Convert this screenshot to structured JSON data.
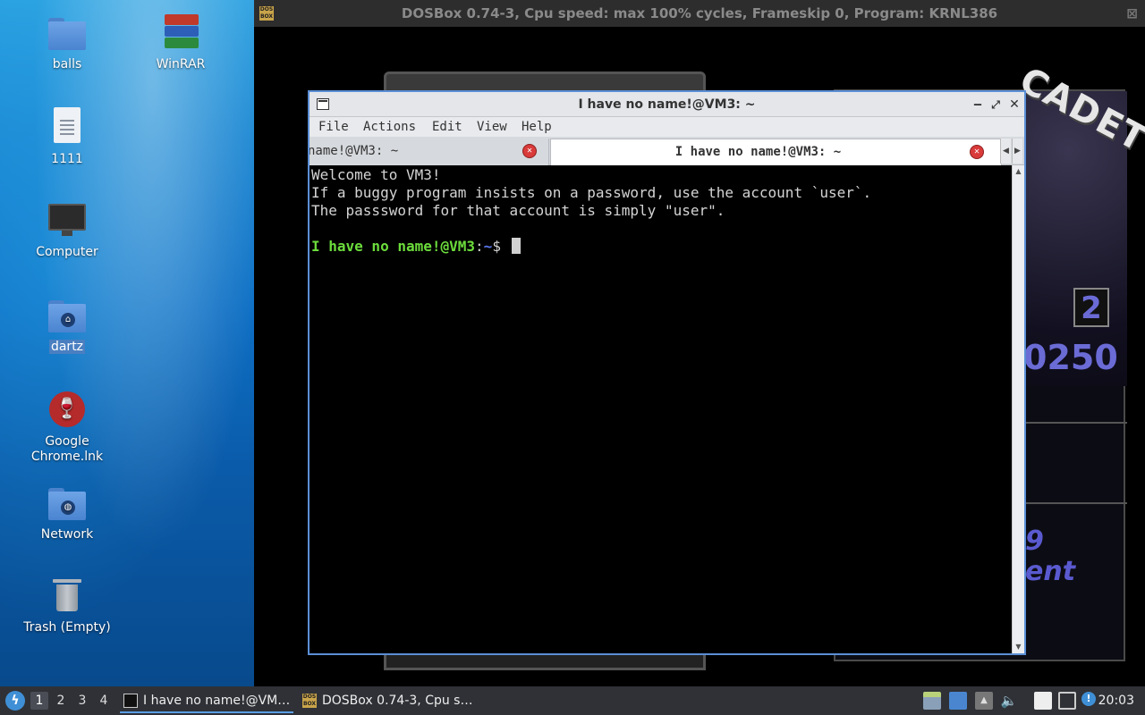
{
  "desktop": {
    "icons": [
      {
        "label": "balls",
        "icon": "folder-icon"
      },
      {
        "label": "WinRAR",
        "icon": "winrar-icon"
      },
      {
        "label": "1111",
        "icon": "text-document-icon"
      },
      {
        "label": "Computer",
        "icon": "computer-icon"
      },
      {
        "label": "dartz",
        "icon": "home-folder-icon"
      },
      {
        "label": "Google Chrome.lnk",
        "icon": "wine-icon"
      },
      {
        "label": "Network",
        "icon": "network-folder-icon"
      },
      {
        "label": "Trash (Empty)",
        "icon": "trash-icon"
      }
    ]
  },
  "dosbox": {
    "title": "DOSBox 0.74-3, Cpu speed: max 100% cycles, Frameskip  0, Program:  KRNL386",
    "game": {
      "logo_text": "CADET",
      "ball_number": "2",
      "score": "0250",
      "message_line1": "9",
      "message_line2": "ent"
    }
  },
  "terminal": {
    "title": "I have no name!@VM3: ~",
    "menu": [
      "File",
      "Actions",
      "Edit",
      "View",
      "Help"
    ],
    "tabs": [
      {
        "label": "name!@VM3: ~"
      },
      {
        "label": "I have no name!@VM3: ~"
      }
    ],
    "lines": [
      "Welcome to VM3!",
      "If a buggy program insists on a password, use the account `user`.",
      "The passsword for that account is simply \"user\"."
    ],
    "prompt_user": "I have no name!@VM3",
    "prompt_sep": ":",
    "prompt_dir": "~",
    "prompt_symbol": "$"
  },
  "taskbar": {
    "workspaces": [
      "1",
      "2",
      "3",
      "4"
    ],
    "active_workspace": "1",
    "tasks": [
      {
        "label": "I have no name!@VM…",
        "icon": "terminal-icon"
      },
      {
        "label": "DOSBox 0.74-3, Cpu s…",
        "icon": "dosbox-icon"
      }
    ],
    "tray_icons": [
      "removable-drive-icon",
      "window-icon",
      "eject-icon",
      "volume-icon",
      "clipboard-icon",
      "network-icon",
      "update-notifier-icon"
    ],
    "clock": "20:03"
  },
  "colors": {
    "prompt_green": "#6cdc3c",
    "prompt_blue": "#5c78f0",
    "window_border": "#5b8fd6",
    "taskbar_bg": "#2f3136"
  }
}
